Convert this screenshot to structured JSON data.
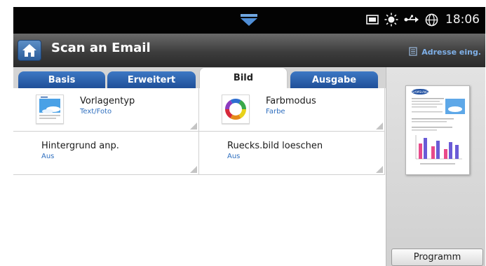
{
  "status": {
    "time": "18:06",
    "icons": [
      "tray-icon",
      "brightness-icon",
      "usb-icon",
      "network-globe-icon"
    ]
  },
  "header": {
    "title": "Scan an Email",
    "address_label": "Adresse eing.",
    "home_icon": "home-icon",
    "address_icon": "address-book-icon"
  },
  "tabs": [
    {
      "label": "Basis",
      "active": false
    },
    {
      "label": "Erweitert",
      "active": false
    },
    {
      "label": "Bild",
      "active": true
    },
    {
      "label": "Ausgabe",
      "active": false
    }
  ],
  "options": [
    {
      "name": "Vorlagentyp",
      "value": "Text/Foto",
      "icon": "original-type-icon"
    },
    {
      "name": "Farbmodus",
      "value": "Farbe",
      "icon": "color-mode-icon"
    },
    {
      "name": "Hintergrund anp.",
      "value": "Aus"
    },
    {
      "name": "Ruecks.bild loeschen",
      "value": "Aus"
    }
  ],
  "preview": {
    "icon": "document-preview-icon",
    "brand": "SAMSUNG"
  },
  "program_button": "Programm",
  "colors": {
    "tab_blue": "#2c62ad",
    "value_blue": "#2f6fbf",
    "title_bar": "#3d3d3d",
    "status_bar": "#030303"
  }
}
